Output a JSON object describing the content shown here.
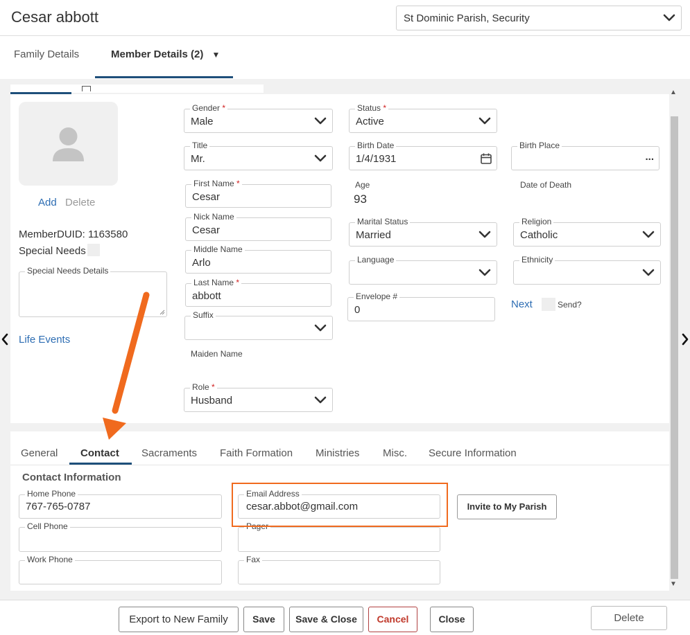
{
  "header": {
    "title": "Cesar abbott",
    "parish_select": "St Dominic Parish, Security"
  },
  "top_tabs": [
    {
      "label": "Family Details"
    },
    {
      "label": "Member Details (2)"
    }
  ],
  "photo": {
    "add_label": "Add",
    "delete_label": "Delete"
  },
  "member": {
    "duid": "MemberDUID: 1163580",
    "special_needs_label": "Special Needs",
    "special_needs_details_label": "Special Needs Details",
    "life_events_label": "Life Events"
  },
  "fields": {
    "gender": {
      "label": "Gender",
      "required": "*",
      "value": "Male"
    },
    "title": {
      "label": "Title",
      "value": "Mr."
    },
    "first_name": {
      "label": "First Name",
      "required": "*",
      "value": "Cesar"
    },
    "nick_name": {
      "label": "Nick Name",
      "value": "Cesar"
    },
    "middle_name": {
      "label": "Middle Name",
      "value": "Arlo"
    },
    "last_name": {
      "label": "Last Name",
      "required": "*",
      "value": "abbott"
    },
    "suffix": {
      "label": "Suffix",
      "value": ""
    },
    "maiden_name": {
      "label": "Maiden Name"
    },
    "role": {
      "label": "Role",
      "required": "*",
      "value": "Husband"
    },
    "status": {
      "label": "Status",
      "required": "*",
      "value": "Active"
    },
    "birth_date": {
      "label": "Birth Date",
      "value": "1/4/1931"
    },
    "age": {
      "label": "Age",
      "value": "93"
    },
    "marital_status": {
      "label": "Marital Status",
      "value": "Married"
    },
    "language": {
      "label": "Language",
      "value": ""
    },
    "envelope": {
      "label": "Envelope #",
      "value": "0"
    },
    "birth_place": {
      "label": "Birth Place",
      "value": "",
      "more": "..."
    },
    "date_of_death": {
      "label": "Date of Death"
    },
    "religion": {
      "label": "Religion",
      "value": "Catholic"
    },
    "ethnicity": {
      "label": "Ethnicity",
      "value": ""
    },
    "next_label": "Next",
    "send_label": "Send?"
  },
  "bottom_tabs": [
    {
      "label": "General"
    },
    {
      "label": "Contact"
    },
    {
      "label": "Sacraments"
    },
    {
      "label": "Faith Formation"
    },
    {
      "label": "Ministries"
    },
    {
      "label": "Misc."
    },
    {
      "label": "Secure Information"
    }
  ],
  "contact": {
    "section_title": "Contact Information",
    "home_phone": {
      "label": "Home Phone",
      "value": "767-765-0787"
    },
    "cell_phone": {
      "label": "Cell Phone",
      "value": ""
    },
    "work_phone": {
      "label": "Work Phone",
      "value": ""
    },
    "email": {
      "label": "Email Address",
      "value": "cesar.abbot@gmail.com"
    },
    "pager": {
      "label": "Pager",
      "value": ""
    },
    "fax": {
      "label": "Fax",
      "value": ""
    },
    "invite_label": "Invite to My Parish"
  },
  "footer": {
    "export_label": "Export to New Family",
    "save_label": "Save",
    "save_close_label": "Save & Close",
    "cancel_label": "Cancel",
    "close_label": "Close",
    "delete_label": "Delete"
  },
  "colors": {
    "accent": "#1e4f7a",
    "link": "#2d6db3",
    "required": "#d02020",
    "highlight": "#f06a1e",
    "cancel": "#c0392b"
  }
}
